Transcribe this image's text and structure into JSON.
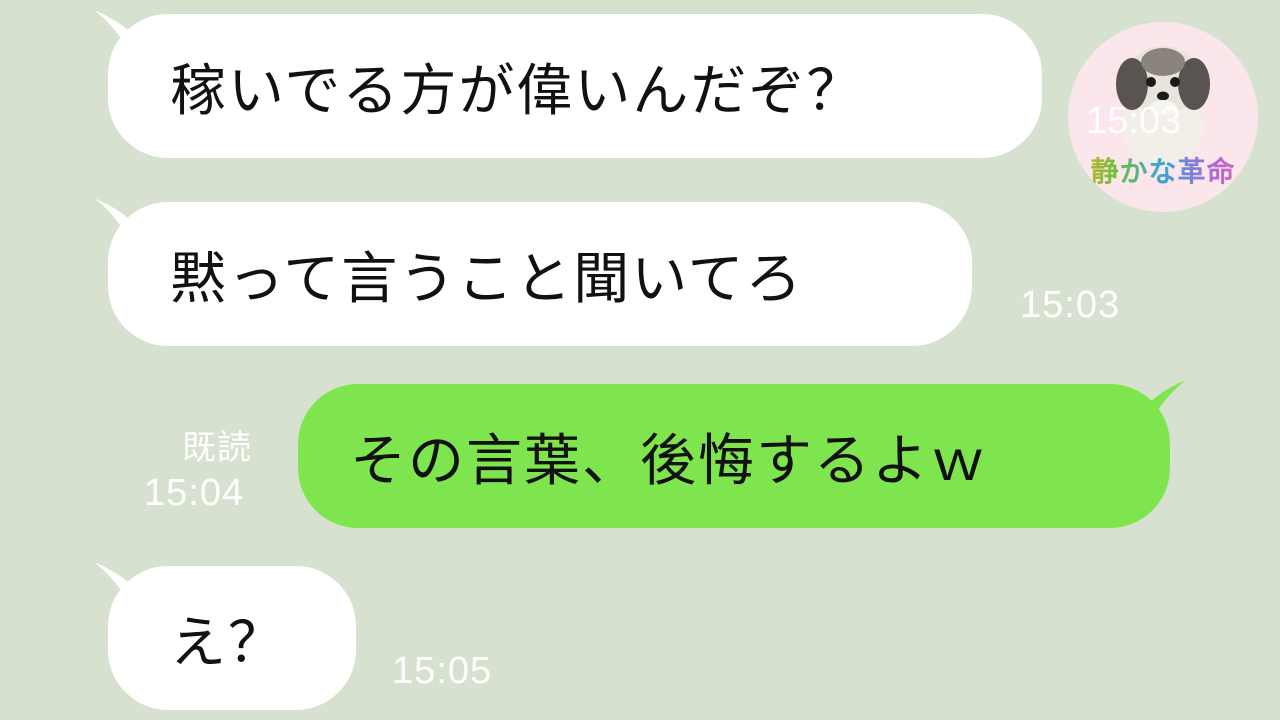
{
  "messages": [
    {
      "id": "msg1",
      "side": "incoming",
      "text": "稼いでる方が偉いんだぞ？"
    },
    {
      "id": "msg2",
      "side": "incoming",
      "text": "黙って言うこと聞いてろ",
      "time": "15:03"
    },
    {
      "id": "msg3",
      "side": "outgoing",
      "text": "その言葉、後悔するよｗ",
      "read": "既読",
      "time": "15:04"
    },
    {
      "id": "msg4",
      "side": "incoming",
      "text": "え？",
      "time": "15:05"
    }
  ],
  "avatar": {
    "time": "15:03",
    "brand": "静かな革命",
    "icon": "dog-photo-icon"
  },
  "colors": {
    "background": "#d6e2cf",
    "incoming_bubble": "#ffffff",
    "outgoing_bubble": "#7fe54e",
    "timestamp": "#ffffff"
  }
}
